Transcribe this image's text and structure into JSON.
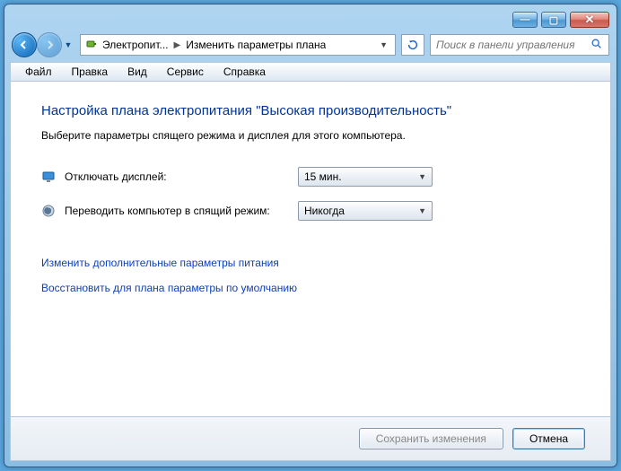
{
  "titlebar": {
    "minimize": "—",
    "maximize": "▢",
    "close": "✕"
  },
  "nav": {
    "back": "←",
    "forward": "→"
  },
  "breadcrumb": {
    "crumb1": "Электропит...",
    "crumb2": "Изменить параметры плана"
  },
  "search": {
    "placeholder": "Поиск в панели управления"
  },
  "menu": {
    "file": "Файл",
    "edit": "Правка",
    "view": "Вид",
    "tools": "Сервис",
    "help": "Справка"
  },
  "page": {
    "title": "Настройка плана электропитания \"Высокая производительность\"",
    "desc": "Выберите параметры спящего режима и дисплея для этого компьютера."
  },
  "settings": {
    "display_off_label": "Отключать дисплей:",
    "display_off_value": "15 мин.",
    "sleep_label": "Переводить компьютер в спящий режим:",
    "sleep_value": "Никогда"
  },
  "links": {
    "advanced": "Изменить дополнительные параметры питания",
    "restore": "Восстановить для плана параметры по умолчанию"
  },
  "buttons": {
    "save": "Сохранить изменения",
    "cancel": "Отмена"
  }
}
